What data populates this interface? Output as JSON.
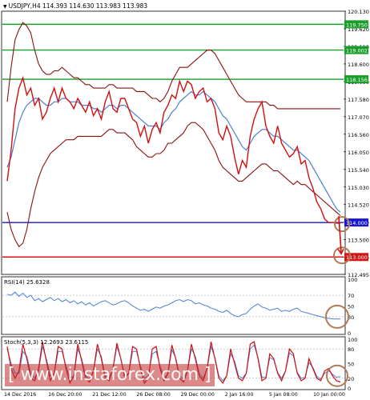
{
  "header": {
    "symbol_line": "USDJPY,H4  114.393 114.630 113.983 113.983"
  },
  "price_axis_ticks": [
    "120.130",
    "119.620",
    "119.110",
    "118.600",
    "118.090",
    "117.580",
    "117.070",
    "116.560",
    "116.050",
    "115.540",
    "115.030",
    "114.520",
    "114.010",
    "113.500",
    "112.990",
    "112.495"
  ],
  "levels": [
    {
      "label": "119.750",
      "value": 119.75,
      "color": "#1a9e2a",
      "text": "#ffffff"
    },
    {
      "label": "119.002",
      "value": 119.002,
      "color": "#1a9e2a",
      "text": "#ffffff"
    },
    {
      "label": "118.156",
      "value": 118.156,
      "color": "#1a9e2a",
      "text": "#ffffff"
    },
    {
      "label": "114.000",
      "value": 114.0,
      "color": "#1515d0",
      "text": "#ffffff"
    },
    {
      "label": "113.000",
      "value": 113.0,
      "color": "#d01515",
      "text": "#ffffff"
    }
  ],
  "rsi": {
    "label": "RSI(14) 25.6328",
    "axis_ticks": [
      "100",
      "70",
      "50",
      "30",
      "0"
    ]
  },
  "stoch": {
    "label": "Stoch(5,3,3) 12.2693 23.6115",
    "axis_ticks": [
      "100",
      "80",
      "50",
      "20",
      "0"
    ]
  },
  "time_labels": [
    "14 Dec 2016",
    "16 Dec 20:00",
    "21 Dec 12:00",
    "26 Dec 08:00",
    "29 Dec 00:00",
    "2 Jan 16:00",
    "5 Jan 08:00",
    "10 Jan 00:00"
  ],
  "watermark": "[ www.instaforex.com ]",
  "colors": {
    "price_line": "#d01010",
    "ma": "#4a7fd6",
    "bands": "#8a1010",
    "rsi": "#4a7fd6",
    "stoch_main": "#d01010",
    "stoch_signal": "#4a7fd6",
    "marker_circle": "#b07a55"
  },
  "chart_data": {
    "type": "line",
    "title": "USDJPY,H4",
    "ylim": [
      112.495,
      120.13
    ],
    "x": [
      0,
      2,
      4,
      6,
      8,
      10,
      12,
      14,
      16,
      18,
      20,
      22,
      24,
      26,
      28,
      30,
      32,
      34,
      36,
      38,
      40,
      42,
      44,
      46,
      48,
      50,
      52,
      54,
      56,
      58,
      60,
      62,
      64,
      66,
      68,
      70,
      72,
      74,
      76,
      78,
      80,
      82,
      84,
      86,
      88,
      90,
      92,
      94,
      96,
      98,
      100,
      102,
      104,
      106,
      108,
      110,
      112,
      114,
      116,
      118,
      120,
      122,
      124,
      126,
      128,
      130,
      132,
      134,
      136,
      138,
      140,
      142,
      144,
      146,
      148,
      150,
      152,
      154,
      156,
      158,
      160,
      162,
      164,
      166,
      168,
      170
    ],
    "series": [
      {
        "values": [
          115.2,
          116.1,
          117.3,
          117.9,
          118.2,
          117.7,
          117.9,
          117.4,
          117.6,
          117.0,
          117.2,
          117.6,
          117.9,
          117.5,
          117.9,
          117.6,
          117.5,
          117.3,
          117.6,
          117.4,
          117.2,
          117.5,
          117.1,
          117.3,
          117.0,
          117.5,
          117.8,
          117.3,
          117.2,
          117.6,
          117.6,
          117.3,
          117.0,
          116.9,
          116.5,
          116.8,
          116.3,
          116.7,
          116.9,
          116.6,
          117.2,
          117.4,
          117.7,
          117.6,
          118.1,
          117.8,
          118.1,
          118.0,
          117.6,
          117.8,
          117.9,
          117.5,
          117.6,
          117.3,
          116.6,
          116.4,
          116.8,
          116.5,
          115.9,
          115.4,
          115.8,
          115.6,
          116.5,
          117.0,
          117.3,
          117.5,
          116.8,
          116.5,
          116.3,
          116.8,
          116.3,
          116.1,
          115.9,
          116.0,
          116.2,
          115.7,
          115.8,
          115.3,
          115.0,
          114.6,
          114.4,
          114.1,
          114.0,
          114.0,
          113.983,
          113.983
        ]
      },
      {
        "values": [
          115.6,
          115.9,
          116.4,
          116.9,
          117.2,
          117.4,
          117.5,
          117.6,
          117.6,
          117.5,
          117.4,
          117.4,
          117.5,
          117.5,
          117.6,
          117.6,
          117.5,
          117.5,
          117.5,
          117.4,
          117.4,
          117.4,
          117.3,
          117.3,
          117.2,
          117.3,
          117.4,
          117.4,
          117.3,
          117.4,
          117.4,
          117.3,
          117.2,
          117.1,
          117.0,
          116.9,
          116.8,
          116.8,
          116.8,
          116.7,
          116.9,
          117.0,
          117.2,
          117.3,
          117.5,
          117.6,
          117.7,
          117.8,
          117.7,
          117.7,
          117.8,
          117.7,
          117.6,
          117.5,
          117.3,
          117.1,
          117.0,
          116.8,
          116.6,
          116.4,
          116.2,
          116.1,
          116.3,
          116.5,
          116.6,
          116.7,
          116.7,
          116.6,
          116.5,
          116.5,
          116.4,
          116.3,
          116.2,
          116.1,
          116.1,
          116.0,
          115.9,
          115.8,
          115.6,
          115.4,
          115.2,
          115.0,
          114.8,
          114.6,
          114.4,
          114.3
        ]
      }
    ],
    "bands_upper": [
      117.5,
      118.5,
      119.3,
      119.6,
      119.8,
      119.7,
      119.5,
      119.0,
      118.6,
      118.4,
      118.3,
      118.3,
      118.4,
      118.4,
      118.5,
      118.4,
      118.3,
      118.2,
      118.2,
      118.1,
      118.0,
      118.0,
      117.9,
      117.9,
      117.9,
      117.9,
      118.0,
      118.0,
      117.9,
      117.9,
      117.9,
      117.9,
      117.9,
      117.8,
      117.8,
      117.8,
      117.7,
      117.6,
      117.6,
      117.5,
      117.6,
      117.8,
      118.1,
      118.3,
      118.5,
      118.5,
      118.5,
      118.6,
      118.7,
      118.8,
      118.9,
      119.0,
      119.0,
      118.9,
      118.7,
      118.5,
      118.3,
      118.1,
      117.9,
      117.7,
      117.6,
      117.5,
      117.5,
      117.5,
      117.5,
      117.5,
      117.5,
      117.4,
      117.4,
      117.3,
      117.3,
      117.3,
      117.3,
      117.3,
      117.3,
      117.3,
      117.3,
      117.3,
      117.3,
      117.3,
      117.3,
      117.3,
      117.3,
      117.3,
      117.3,
      117.3
    ],
    "bands_lower": [
      114.3,
      113.8,
      113.5,
      113.3,
      113.4,
      113.8,
      114.4,
      114.9,
      115.3,
      115.6,
      115.8,
      116.0,
      116.1,
      116.2,
      116.3,
      116.4,
      116.4,
      116.4,
      116.5,
      116.5,
      116.5,
      116.5,
      116.5,
      116.5,
      116.5,
      116.6,
      116.7,
      116.7,
      116.6,
      116.6,
      116.6,
      116.5,
      116.4,
      116.2,
      116.1,
      116.0,
      115.9,
      115.9,
      116.0,
      116.0,
      116.1,
      116.3,
      116.3,
      116.4,
      116.5,
      116.6,
      116.8,
      116.9,
      116.9,
      116.8,
      116.7,
      116.5,
      116.3,
      116.1,
      115.8,
      115.6,
      115.5,
      115.4,
      115.3,
      115.2,
      115.2,
      115.3,
      115.4,
      115.5,
      115.6,
      115.7,
      115.7,
      115.6,
      115.5,
      115.5,
      115.4,
      115.3,
      115.2,
      115.1,
      115.2,
      115.1,
      115.1,
      115.0,
      114.9,
      114.8,
      114.7,
      114.6,
      114.5,
      114.4,
      114.3,
      114.2
    ],
    "rsi_values": [
      72,
      70,
      76,
      68,
      74,
      66,
      70,
      60,
      64,
      58,
      62,
      66,
      60,
      64,
      58,
      62,
      56,
      60,
      54,
      58,
      52,
      56,
      50,
      54,
      58,
      60,
      56,
      52,
      54,
      58,
      60,
      56,
      50,
      46,
      42,
      44,
      40,
      44,
      48,
      46,
      50,
      52,
      56,
      60,
      62,
      58,
      62,
      60,
      54,
      56,
      52,
      50,
      46,
      44,
      40,
      38,
      42,
      36,
      32,
      30,
      34,
      36,
      44,
      50,
      54,
      48,
      46,
      42,
      44,
      46,
      40,
      42,
      40,
      44,
      46,
      40,
      38,
      36,
      34,
      32,
      30,
      28,
      27,
      26,
      25.8,
      25.6
    ],
    "stoch_main": [
      85,
      40,
      20,
      35,
      90,
      60,
      20,
      15,
      40,
      95,
      55,
      15,
      30,
      85,
      80,
      40,
      10,
      25,
      90,
      55,
      20,
      12,
      35,
      90,
      60,
      20,
      15,
      40,
      92,
      60,
      20,
      30,
      85,
      80,
      40,
      10,
      20,
      80,
      85,
      40,
      15,
      30,
      88,
      60,
      20,
      12,
      35,
      90,
      60,
      25,
      15,
      40,
      95,
      60,
      20,
      10,
      25,
      80,
      50,
      20,
      15,
      30,
      90,
      95,
      60,
      15,
      20,
      70,
      60,
      30,
      15,
      35,
      80,
      70,
      30,
      15,
      20,
      60,
      40,
      20,
      15,
      35,
      40,
      25,
      15,
      12.3
    ],
    "stoch_signal": [
      80,
      50,
      30,
      30,
      75,
      65,
      30,
      20,
      35,
      85,
      60,
      25,
      30,
      75,
      75,
      45,
      20,
      25,
      80,
      60,
      25,
      18,
      35,
      80,
      65,
      25,
      20,
      40,
      85,
      60,
      25,
      30,
      75,
      75,
      45,
      20,
      25,
      70,
      75,
      45,
      20,
      30,
      78,
      62,
      25,
      18,
      35,
      80,
      65,
      30,
      20,
      40,
      85,
      62,
      25,
      15,
      25,
      70,
      55,
      25,
      20,
      30,
      80,
      88,
      62,
      22,
      22,
      62,
      58,
      32,
      20,
      35,
      72,
      66,
      32,
      20,
      22,
      52,
      42,
      24,
      18,
      30,
      36,
      28,
      22,
      23.6
    ]
  }
}
